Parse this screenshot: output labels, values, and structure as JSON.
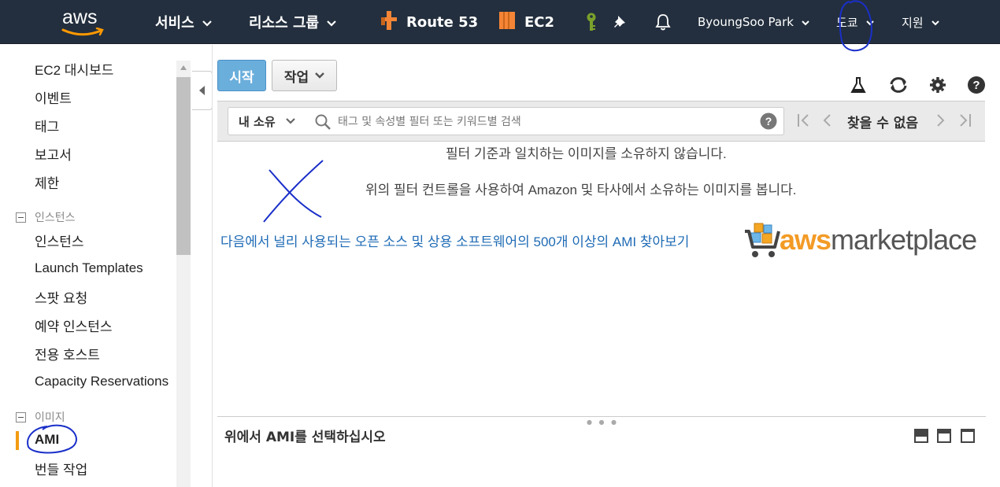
{
  "nav": {
    "logo": "aws",
    "services": "서비스",
    "resource_groups": "리소스 그룹",
    "route53": "Route 53",
    "ec2": "EC2",
    "user": "ByoungSoo Park",
    "region": "도쿄",
    "support": "지원",
    "colors": {
      "bar": "#232f3e",
      "route53_icon": "#f58536",
      "ec2_icon": "#f58536",
      "key_icon": "#6b8e23"
    }
  },
  "sidebar": {
    "links": {
      "dashboard": "EC2 대시보드",
      "events": "이벤트",
      "tags": "태그",
      "reports": "보고서",
      "limits": "제한",
      "instances": "인스턴스",
      "launch_templates": "Launch Templates",
      "spot_requests": "스팟 요청",
      "reserved_instances": "예약 인스턴스",
      "dedicated_hosts": "전용 호스트",
      "capacity_reservations": "Capacity Reservations",
      "ami": "AMI",
      "bundle_tasks": "번들 작업"
    },
    "groups": {
      "instances": "인스턴스",
      "images": "이미지"
    },
    "active_color": "#f39c12"
  },
  "toolbar": {
    "start": "시작",
    "actions": "작업"
  },
  "filter": {
    "ownership": "내 소유",
    "search_placeholder": "태그 및 속성별 필터 또는 키워드별 검색",
    "pager_text": "찾을 수 없음"
  },
  "content": {
    "no_images": "필터 기준과 일치하는 이미지를 소유하지 않습니다.",
    "hint": "위의 필터 컨트롤을 사용하여 Amazon 및 타사에서 소유하는 이미지를 봅니다.",
    "marketplace_link": "다음에서 널리 사용되는 오픈 소스 및 상용 소프트웨어의 500개 이상의 AMI 찾아보기",
    "marketplace_logo_aws": "aws",
    "marketplace_logo_rest": "marketplace"
  },
  "detail": {
    "title": "위에서 AMI를 선택하십시오"
  }
}
